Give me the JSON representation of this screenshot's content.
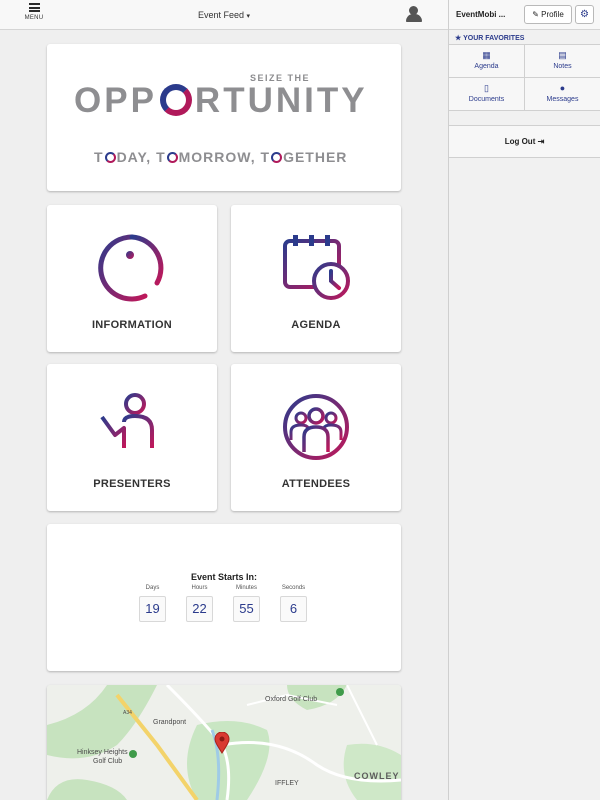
{
  "header": {
    "menu_label": "MENU",
    "feed_title": "Event Feed",
    "feed_caret": "▾"
  },
  "banner": {
    "kicker": "SEIZE THE",
    "title_start": "OPP",
    "title_end": "RTUNITY",
    "tag_1": "T",
    "tag_2": "DAY, T",
    "tag_3": "MORROW, T",
    "tag_4": "GETHER"
  },
  "tiles": [
    {
      "label": "INFORMATION",
      "icon": "info-icon"
    },
    {
      "label": "AGENDA",
      "icon": "calendar-clock-icon"
    },
    {
      "label": "PRESENTERS",
      "icon": "presenter-icon"
    },
    {
      "label": "ATTENDEES",
      "icon": "group-icon"
    }
  ],
  "countdown": {
    "title": "Event Starts In:",
    "units": [
      {
        "label": "Days",
        "value": "19"
      },
      {
        "label": "Hours",
        "value": "22"
      },
      {
        "label": "Minutes",
        "value": "55"
      },
      {
        "label": "Seconds",
        "value": "6"
      }
    ]
  },
  "map": {
    "labels": [
      "Oxford Golf Club",
      "Grandpont",
      "Hinksey Heights",
      "Golf Club",
      "IFFLEY",
      "COWLEY",
      "A34"
    ]
  },
  "panel": {
    "app_name": "EventMobi ...",
    "profile_label": "Profile",
    "favorites_heading": "★ YOUR FAVORITES",
    "favorites": [
      {
        "label": "Agenda",
        "icon": "calendar-icon"
      },
      {
        "label": "Notes",
        "icon": "note-icon"
      },
      {
        "label": "Documents",
        "icon": "document-icon"
      },
      {
        "label": "Messages",
        "icon": "chat-icon"
      }
    ],
    "logout_label": "Log Out"
  },
  "colors": {
    "brand_navy": "#2b3b8c",
    "brand_magenta": "#b0195a",
    "marker": "#d93a32"
  }
}
